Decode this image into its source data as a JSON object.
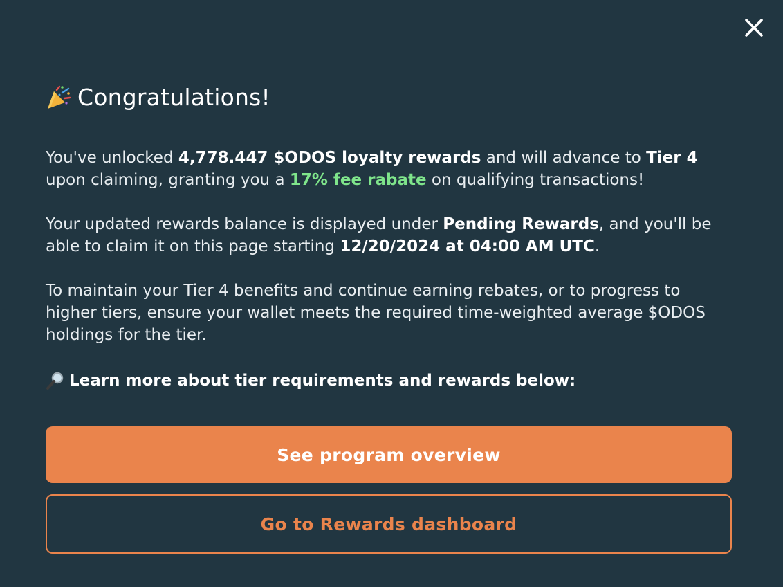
{
  "modal": {
    "close_icon": "close-icon",
    "title_icon": "party-popper-icon",
    "title": "Congratulations!",
    "p1": {
      "t1": "You've unlocked ",
      "amount": "4,778.447 $ODOS loyalty rewards",
      "t2": " and will advance to ",
      "tier": "Tier 4",
      "t3": " upon claiming, granting you a ",
      "rebate": "17% fee rabate",
      "t4": " on qualifying transactions!"
    },
    "p2": {
      "t1": "Your updated rewards balance is displayed under ",
      "pending": "Pending Rewards",
      "t2": ", and you'll be able to claim it on this page starting ",
      "date": "12/20/2024 at 04:00 AM UTC",
      "t3": "."
    },
    "p3": "To maintain your Tier 4 benefits and continue earning rebates, or to progress to higher tiers, ensure your wallet meets the required time-weighted average $ODOS holdings for the tier.",
    "learn_icon": "magnifying-glass-icon",
    "learn_more": "Learn more about tier requirements and rewards below:",
    "primary_button": "See program overview",
    "secondary_button": "Go to Rewards dashboard"
  },
  "colors": {
    "background": "#213641",
    "accent": "#ea844c",
    "highlight_green": "#7fe58b"
  }
}
